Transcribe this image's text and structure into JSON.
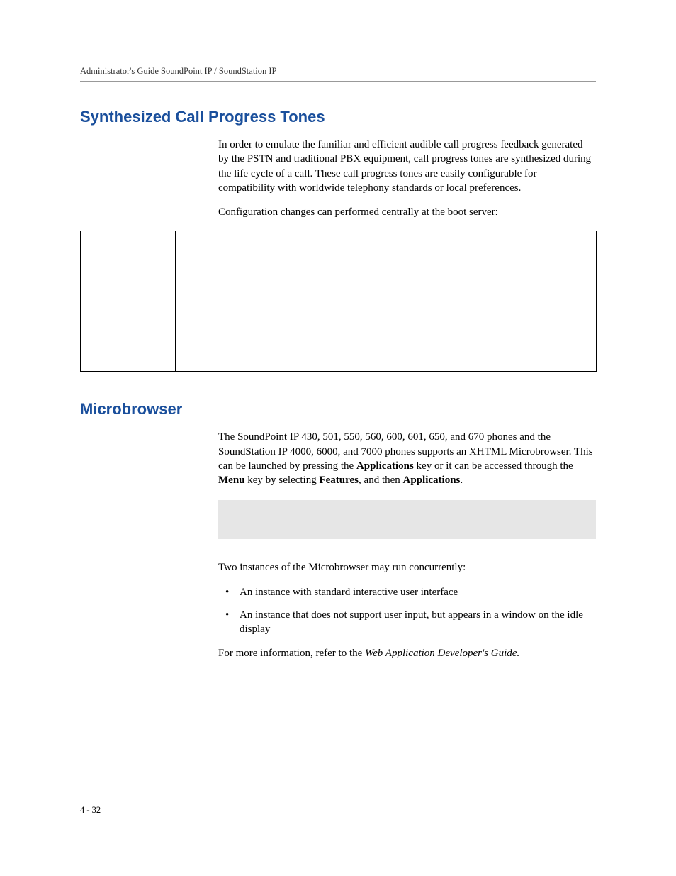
{
  "header": {
    "running_head": "Administrator's Guide SoundPoint IP / SoundStation IP"
  },
  "section1": {
    "heading": "Synthesized Call Progress Tones",
    "para1": "In order to emulate the familiar and efficient audible call progress feedback generated by the PSTN and traditional PBX equipment, call progress tones are synthesized during the life cycle of a call. These call progress tones are easily configurable for compatibility with worldwide telephony standards or local preferences.",
    "para2": "Configuration changes can performed centrally at the boot server:"
  },
  "section2": {
    "heading": "Microbrowser",
    "para1_pre": "The SoundPoint IP 430, 501, 550, 560, 600, 601, 650, and 670 phones and the SoundStation IP 4000, 6000, and 7000 phones supports an XHTML Microbrowser. This can be launched by pressing the ",
    "bold_applications1": "Applications",
    "para1_mid1": " key or it can be accessed through the ",
    "bold_menu": "Menu",
    "para1_mid2": " key by selecting ",
    "bold_features": "Features",
    "para1_mid3": ", and then ",
    "bold_applications2": "Applications",
    "para1_end": ".",
    "para2": "Two instances of the Microbrowser may run concurrently:",
    "bullets": [
      "An instance with standard interactive user interface",
      "An instance that does not support user input, but appears in a window on the idle display"
    ],
    "para3_pre": "For more information, refer to the ",
    "para3_italic": "Web Application Developer's Guide.",
    "para3_end": ""
  },
  "footer": {
    "page_number": "4 - 32"
  }
}
